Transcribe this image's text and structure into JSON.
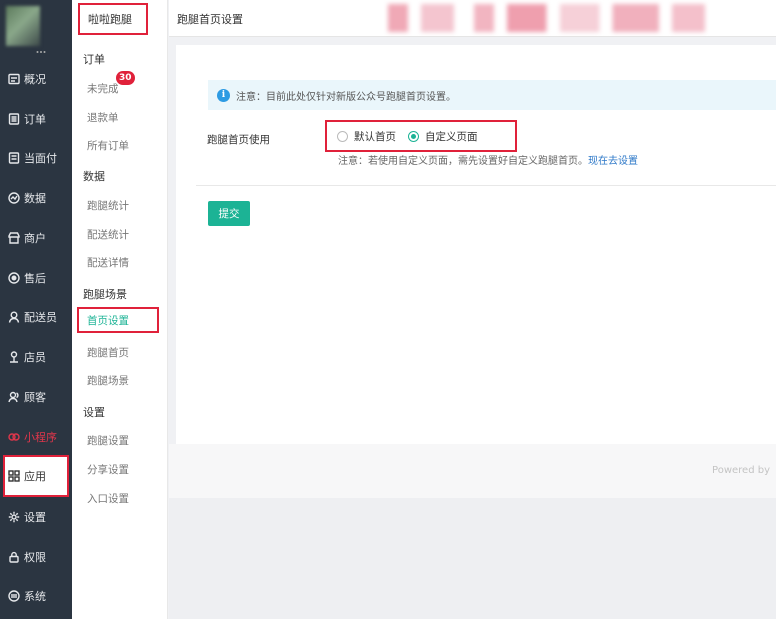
{
  "sidebar": {
    "items": [
      {
        "label": "概况",
        "icon": "overview-icon"
      },
      {
        "label": "订单",
        "icon": "order-icon"
      },
      {
        "label": "当面付",
        "icon": "pay-icon"
      },
      {
        "label": "数据",
        "icon": "data-icon"
      },
      {
        "label": "商户",
        "icon": "merchant-icon"
      },
      {
        "label": "售后",
        "icon": "after-sale-icon"
      },
      {
        "label": "配送员",
        "icon": "courier-icon"
      },
      {
        "label": "店员",
        "icon": "clerk-icon"
      },
      {
        "label": "顾客",
        "icon": "customer-icon"
      },
      {
        "label": "小程序",
        "icon": "mini-program-icon"
      },
      {
        "label": "应用",
        "icon": "apps-icon"
      },
      {
        "label": "设置",
        "icon": "gear-icon"
      },
      {
        "label": "权限",
        "icon": "lock-icon"
      },
      {
        "label": "系统",
        "icon": "system-icon"
      }
    ],
    "highlight_color": "#e0364b"
  },
  "submenu": {
    "title": "啦啦跑腿",
    "order_group": "订单",
    "order_items": [
      "未完成",
      "退款单",
      "所有订单"
    ],
    "badge": "30",
    "data_group": "数据",
    "data_items": [
      "跑腿统计",
      "配送统计",
      "配送详情"
    ],
    "scene_group": "跑腿场景",
    "scene_items": [
      "首页设置",
      "跑腿首页",
      "跑腿场景"
    ],
    "settings_group": "设置",
    "settings_items": [
      "跑腿设置",
      "分享设置",
      "入口设置"
    ]
  },
  "header": {
    "title": "跑腿首页设置"
  },
  "main": {
    "notice": "注意：目前此处仅针对新版公众号跑腿首页设置。",
    "field_label": "跑腿首页使用",
    "option_default": "默认首页",
    "option_custom": "自定义页面",
    "selected": "自定义页面",
    "note": "注意：若使用自定义页面，需先设置好自定义跑腿首页。",
    "note_link": "现在去设置",
    "submit_label": "提交"
  },
  "footer": {
    "powered": "Powered by"
  },
  "colors": {
    "accent": "#1cb395",
    "sidebar_bg": "#2b3541",
    "link": "#2d78c8",
    "annotation": "#e0213a"
  }
}
